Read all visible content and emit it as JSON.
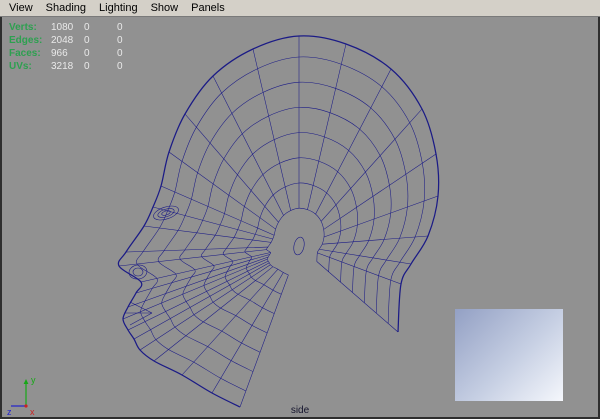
{
  "menu": {
    "items": [
      "View",
      "Shading",
      "Lighting",
      "Show",
      "Panels"
    ]
  },
  "hud": {
    "label_color": "#2da050",
    "value_color": "#e9e9e9",
    "rows": [
      {
        "label": "Verts:",
        "values": [
          "1080",
          "0",
          "0"
        ]
      },
      {
        "label": "Edges:",
        "values": [
          "2048",
          "0",
          "0"
        ]
      },
      {
        "label": "Faces:",
        "values": [
          "966",
          "0",
          "0"
        ]
      },
      {
        "label": "UVs:",
        "values": [
          "3218",
          "0",
          "0"
        ]
      }
    ]
  },
  "viewport": {
    "camera_label": "side",
    "background_color": "#919191",
    "wireframe_color": "#1b1b86",
    "axis": {
      "y": {
        "label": "y",
        "color": "#17a817"
      },
      "z": {
        "label": "z",
        "color": "#2222cc"
      },
      "x": {
        "label": "x",
        "color": "#cc2222"
      }
    }
  },
  "image_plane": {
    "gradient_start": "#93a0c4",
    "gradient_end": "#f5f7fc"
  }
}
